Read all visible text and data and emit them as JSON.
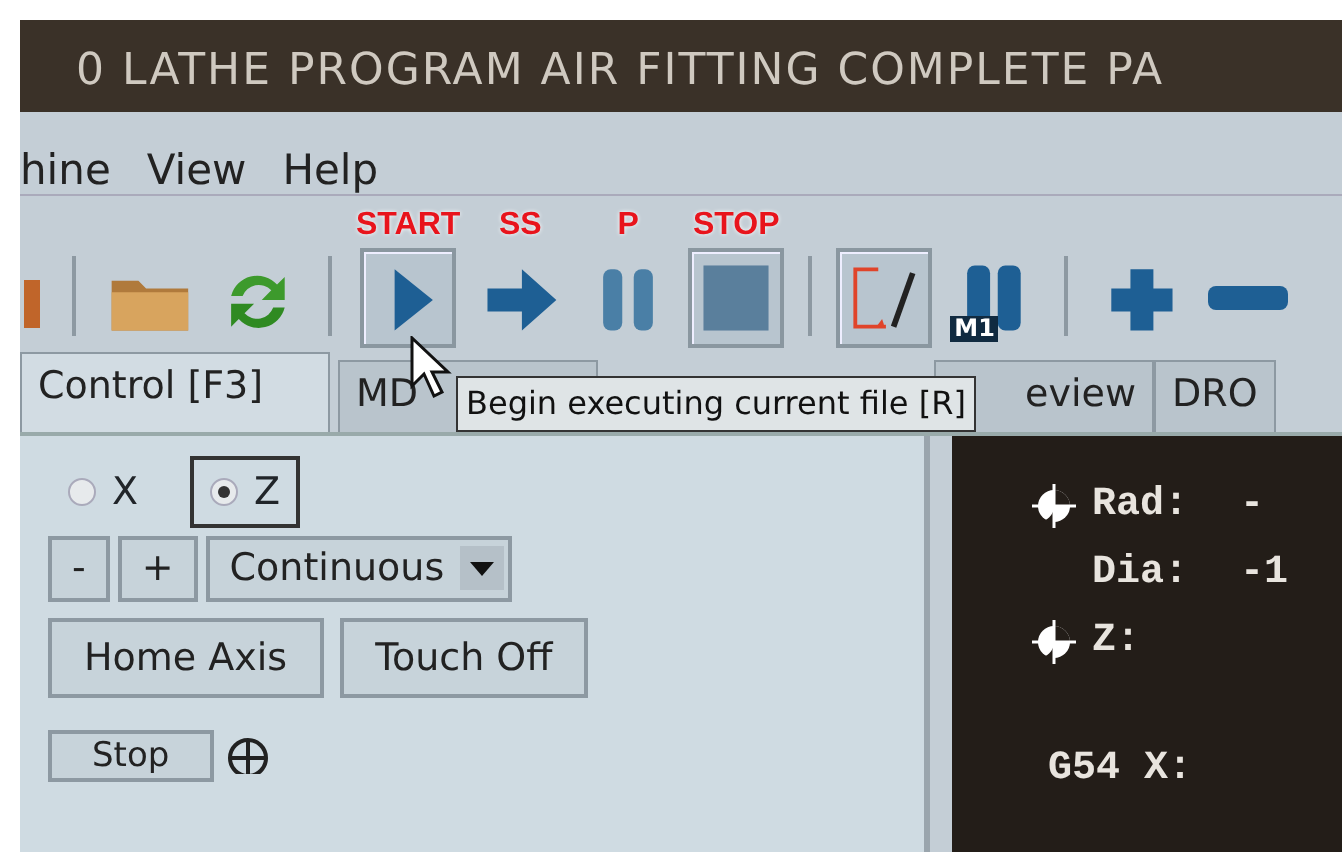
{
  "window": {
    "title": "0 LATHE PROGRAM AIR FITTING COMPLETE PA"
  },
  "menu": [
    {
      "label": "hine"
    },
    {
      "label": "View"
    },
    {
      "label": "Help"
    }
  ],
  "toolbar": [
    {
      "kind": "partial",
      "pressed": false
    },
    {
      "kind": "separator"
    },
    {
      "kind": "open",
      "pressed": false
    },
    {
      "kind": "reload",
      "pressed": false
    },
    {
      "kind": "separator"
    },
    {
      "kind": "run",
      "pressed": true,
      "annotation": "START"
    },
    {
      "kind": "step",
      "pressed": false,
      "annotation": "SS"
    },
    {
      "kind": "pause",
      "pressed": false,
      "annotation": "P"
    },
    {
      "kind": "stop",
      "pressed": true,
      "annotation": "STOP"
    },
    {
      "kind": "separator"
    },
    {
      "kind": "skip",
      "pressed": true
    },
    {
      "kind": "optional-stop",
      "pressed": false,
      "text": "M1"
    },
    {
      "kind": "separator"
    },
    {
      "kind": "zoom-in",
      "pressed": false
    },
    {
      "kind": "zoom-out",
      "pressed": false
    }
  ],
  "tooltip": {
    "text": "Begin executing current file [R]"
  },
  "tabs": [
    {
      "label": "Control [F3]",
      "selected": true
    },
    {
      "label": "MD",
      "selected": false
    },
    {
      "label": "eview",
      "selected": false
    },
    {
      "label": "DRO",
      "selected": false
    }
  ],
  "axis": [
    {
      "label": "X",
      "selected": false
    },
    {
      "label": "Z",
      "selected": true
    }
  ],
  "jog": {
    "minus": "-",
    "plus": "+",
    "mode": "Continuous"
  },
  "buttons": [
    {
      "label": "Home Axis"
    },
    {
      "label": "Touch Off"
    }
  ],
  "bottom_button": {
    "label": "Stop"
  },
  "dro": [
    {
      "label": "Rad:",
      "value": "-",
      "homed": true
    },
    {
      "label": "Dia:",
      "value": "-1",
      "homed": false
    },
    {
      "label": "Z:",
      "homed": true
    },
    {
      "label": "G54 X:",
      "homed": false,
      "gap": true
    }
  ]
}
